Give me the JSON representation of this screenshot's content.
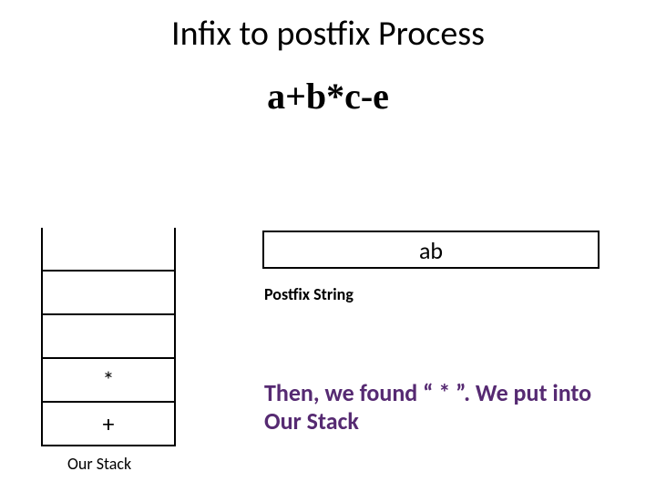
{
  "title": "Infix to postfix Process",
  "expression": "a+b*c-e",
  "postfix": {
    "value": "ab",
    "label": "Postfix String"
  },
  "stack": {
    "cells": [
      "",
      "",
      "",
      "*",
      "+"
    ],
    "label": "Our Stack"
  },
  "caption": "Then, we found “ * ”. We put into Our Stack"
}
